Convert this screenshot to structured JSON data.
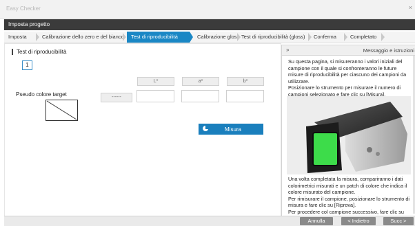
{
  "window": {
    "title": "Easy Checker",
    "close_label": "×"
  },
  "project_bar": {
    "title": "Imposta progetto"
  },
  "steps": [
    {
      "label": "Imposta",
      "active": false
    },
    {
      "label": "Calibrazione dello zero e del bianco",
      "active": false
    },
    {
      "label": "Test di riproducibilità",
      "active": true
    },
    {
      "label": "Calibrazione gloss",
      "active": false
    },
    {
      "label": "Test di riproducibilità (gloss)",
      "active": false
    },
    {
      "label": "Conferma",
      "active": false
    },
    {
      "label": "Completato",
      "active": false
    }
  ],
  "main": {
    "section_title": "Test di riproducibilità",
    "page_number": "1",
    "columns": [
      "L*",
      "a*",
      "b*"
    ],
    "row_label": "Pseudo colore target",
    "swatch_button": "------",
    "values": [
      "",
      "",
      ""
    ],
    "measure_button": "Misura"
  },
  "side_panel": {
    "collapse_label": "»",
    "title": "Messaggio e istruzioni",
    "text_top": "Su questa pagina, si misureranno i valori iniziali del campione con il quale si confronteranno le future misure di riproducibilità per ciascuno dei campioni da utilizzare.\nPosizionare lo strumento per misurare il numero di campioni selezionato e fare clic su [Misura].",
    "text_bottom": "Una volta completata la misura, compariranno i dati colorimetrici misurati e un patch di colore che indica il colore misurato del campione.\nPer rimisurare il campione, posizionare lo strumento di misura e fare clic su [Riprova].\nPer procedere col campione successivo, fare clic su"
  },
  "footer": {
    "cancel": "Annulla",
    "back": "< Indietro",
    "next": "Succ >"
  },
  "colors": {
    "accent": "#1a87c5",
    "dark_bar": "#3b3b3b",
    "footer_button": "#8a8a8a",
    "sample_green": "#3ddc4a"
  }
}
